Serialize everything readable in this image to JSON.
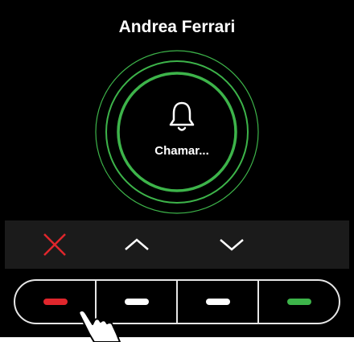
{
  "caller": {
    "name": "Andrea Ferrari"
  },
  "call": {
    "status": "Chamar..."
  },
  "icons": {
    "bell": "bell-icon",
    "reject": "close-x-icon",
    "up": "chevron-up-icon",
    "down": "chevron-down-icon",
    "cursor": "hand-pointer-icon"
  },
  "colors": {
    "background": "#000000",
    "ring": "#3db44a",
    "reject": "#e0262c",
    "led_red": "#e0262c",
    "led_white": "#ffffff",
    "led_green": "#3db44a",
    "softkey_bar": "#1b1b1b"
  },
  "hardware_buttons": [
    {
      "led_color": "red"
    },
    {
      "led_color": "white"
    },
    {
      "led_color": "white"
    },
    {
      "led_color": "green"
    }
  ]
}
